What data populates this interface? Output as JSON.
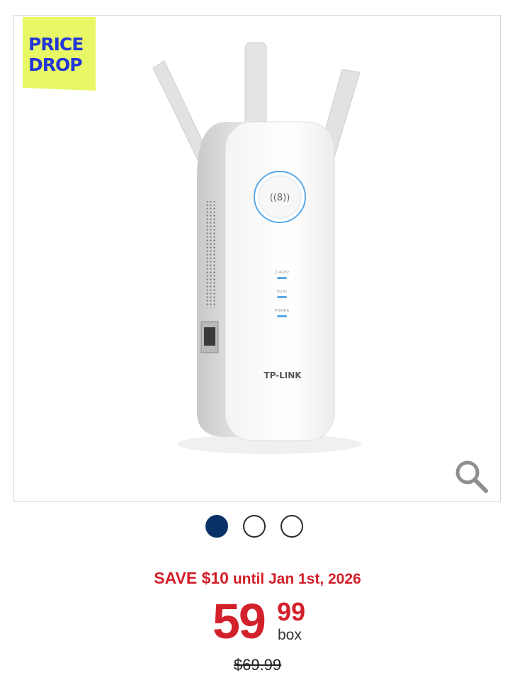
{
  "badge": {
    "line1": "PRICE",
    "line2": "DROP"
  },
  "product": {
    "brand_label": "TP-LINK",
    "leds": [
      "2.4GHz",
      "5GHz",
      "POWER"
    ]
  },
  "gallery": {
    "total": 3,
    "active_index": 0
  },
  "promo": {
    "save_amount": "SAVE $10",
    "save_until": "until Jan 1st, 2026"
  },
  "price": {
    "dollars": "59",
    "cents": "99",
    "unit": "box"
  },
  "original_price": "$69.99",
  "icons": {
    "zoom": "magnifier-icon"
  },
  "colors": {
    "sale_red": "#d21f2a",
    "active_dot": "#0b3266",
    "badge_bg": "#e8f765",
    "badge_text": "#2437d6"
  }
}
